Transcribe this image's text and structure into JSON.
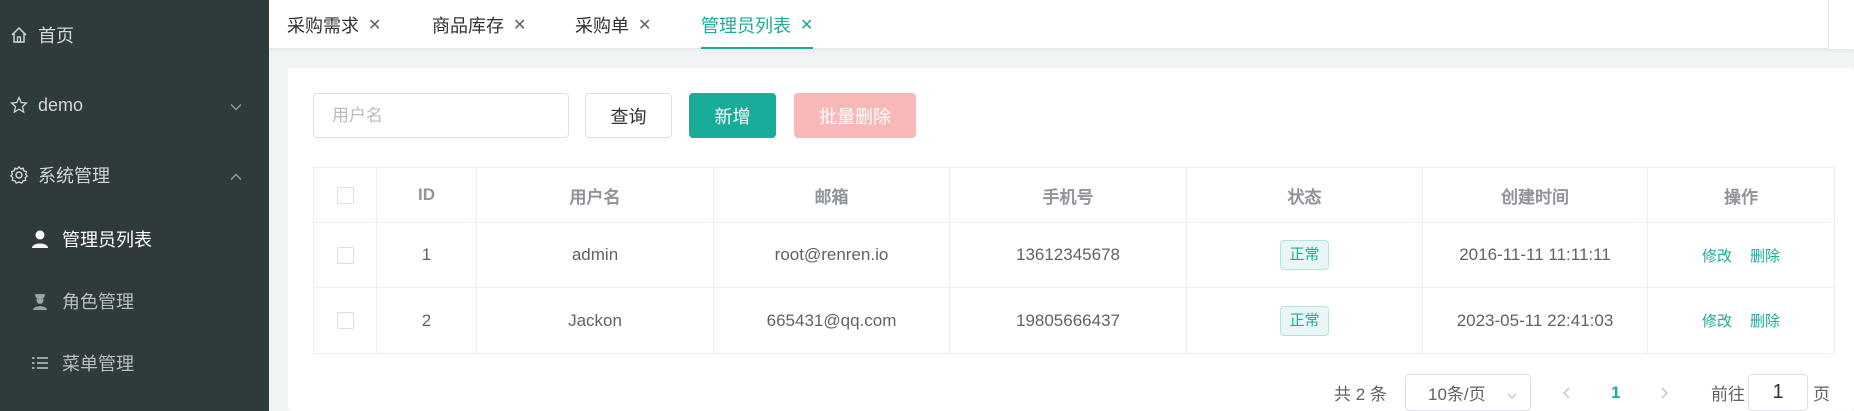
{
  "sidebar": {
    "items": [
      {
        "label": "首页",
        "icon": "home-icon"
      },
      {
        "label": "demo",
        "icon": "star-icon"
      },
      {
        "label": "系统管理",
        "icon": "gear-icon"
      }
    ],
    "submenu": [
      {
        "label": "管理员列表",
        "icon": "user-icon"
      },
      {
        "label": "角色管理",
        "icon": "role-icon"
      },
      {
        "label": "菜单管理",
        "icon": "list-icon"
      }
    ]
  },
  "tabs": [
    {
      "label": "采购需求"
    },
    {
      "label": "商品库存"
    },
    {
      "label": "采购单"
    },
    {
      "label": "管理员列表"
    }
  ],
  "toolbar": {
    "search_placeholder": "用户名",
    "query_label": "查询",
    "add_label": "新增",
    "batch_delete_label": "批量删除"
  },
  "table": {
    "columns": [
      "ID",
      "用户名",
      "邮箱",
      "手机号",
      "状态",
      "创建时间",
      "操作"
    ],
    "rows": [
      {
        "id": "1",
        "username": "admin",
        "email": "root@renren.io",
        "phone": "13612345678",
        "status": "正常",
        "created": "2016-11-11 11:11:11"
      },
      {
        "id": "2",
        "username": "Jackon",
        "email": "665431@qq.com",
        "phone": "19805666437",
        "status": "正常",
        "created": "2023-05-11 22:41:03"
      }
    ],
    "edit_label": "修改",
    "delete_label": "删除"
  },
  "pagination": {
    "total_text": "共 2 条",
    "page_size": "10条/页",
    "current_page": "1",
    "goto_label": "前往",
    "goto_value": "1",
    "page_suffix": "页"
  },
  "colors": {
    "accent": "#19ac9a",
    "sidebar_bg": "#2f3a3c",
    "danger_disabled": "#f7b8b8"
  }
}
